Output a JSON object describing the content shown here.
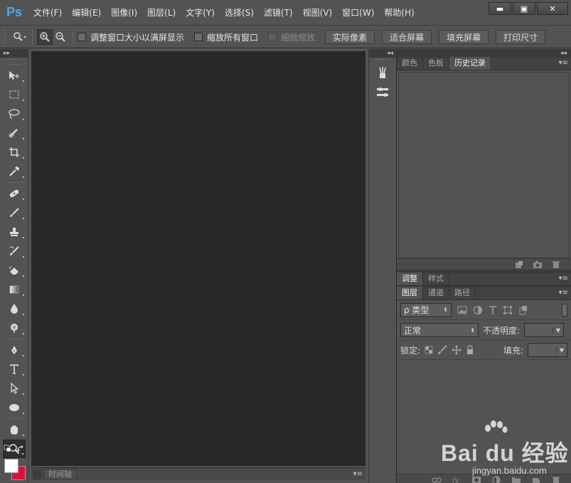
{
  "app": {
    "logo": "Ps"
  },
  "menu": [
    "文件(F)",
    "编辑(E)",
    "图像(I)",
    "图层(L)",
    "文字(Y)",
    "选择(S)",
    "滤镜(T)",
    "视图(V)",
    "窗口(W)",
    "帮助(H)"
  ],
  "window_controls": {
    "minimize": "▬",
    "maximize": "▣",
    "close": "✕"
  },
  "options": {
    "resize_windows": "调整窗口大小以满屏显示",
    "zoom_all": "缩放所有窗口",
    "scrubby_zoom": "细微缩放",
    "actual_pixels": "实际像素",
    "fit_screen": "适合屏幕",
    "fill_screen": "填充屏幕",
    "print_size": "打印尺寸"
  },
  "collapse_glyph": "◂◂",
  "expand_glyph": "▸▸",
  "timeline": {
    "tab": "时间轴"
  },
  "panel_menu_glyph": "▾≡",
  "panels": {
    "top_tabs": [
      "颜色",
      "色板",
      "历史记录"
    ],
    "adjust_tabs": [
      "调整",
      "样式"
    ],
    "layer_tabs": [
      "图层",
      "通道",
      "路径"
    ],
    "filter_type": "ρ 类型",
    "blend_mode": "正常",
    "opacity_label": "不透明度:",
    "lock_label": "锁定:",
    "fill_label": "填充:"
  },
  "colors": {
    "foreground": "#ffffff",
    "background": "#e0103a",
    "accent": "#4fa8e8"
  },
  "watermark": {
    "text": "Bai du 经验",
    "sub": "jingyan.baidu.com"
  }
}
